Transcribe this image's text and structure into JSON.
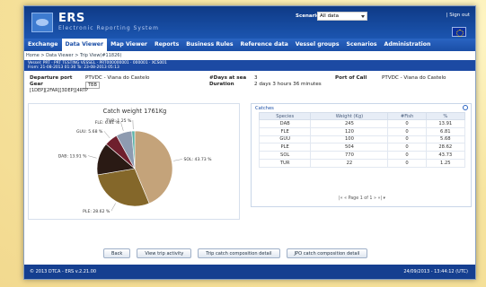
{
  "header": {
    "app_name": "ERS",
    "app_subtitle": "Electronic Reporting System",
    "scenario_label": "Scenario",
    "scenario_value": "All data",
    "sign_out": "| Sign out"
  },
  "nav": [
    "Exchange",
    "Data Viewer",
    "Map Viewer",
    "Reports",
    "Business Rules",
    "Reference data",
    "Vessel groups",
    "Scenarios",
    "Administration"
  ],
  "breadcrumb": "Home > Data Viewer > Trip View(#11826)",
  "vessel_bar": {
    "line1": "Vessel: PRT  ·  PRT TESTING VESSEL  ·  PRT000000001  ·  000001  ·  XCS001",
    "line2": "From: 21-08-2013 01:30 To: 23-08-2013 05:13"
  },
  "trip": {
    "departure_label": "Departure port",
    "departure_value": "PTVDC - Viana do Castelo",
    "gear_label": "Gear",
    "gear_value": "TBB",
    "days_label": "#Days at sea",
    "days_value": "3",
    "duration_label": "Duration",
    "duration_value": "2 days 3 hours 36 minutes",
    "port_label": "Port of Call",
    "port_value": "PTVDC - Viana do Castelo",
    "tags": "[1DEP][2FAR][3DEP][4RTP"
  },
  "chart_data": {
    "type": "pie",
    "title": "Catch weight 1761Kg",
    "series": [
      {
        "name": "SOL",
        "value": 43.73,
        "label": "SOL: 43.73 %",
        "color": "#c4a37a"
      },
      {
        "name": "PLE",
        "value": 28.62,
        "label": "PLE: 28.62 %",
        "color": "#84672a"
      },
      {
        "name": "DAB",
        "value": 13.91,
        "label": "DAB: 13.91 %",
        "color": "#2a1a14"
      },
      {
        "name": "GUU",
        "value": 5.68,
        "label": "GUU: 5.68 %",
        "color": "#6f1f2d"
      },
      {
        "name": "FLE",
        "value": 6.81,
        "label": "FLE: 6.81 %",
        "color": "#8e9bb0"
      },
      {
        "name": "TUR",
        "value": 1.25,
        "label": "TUR: 1.25 %",
        "color": "#5cb3a8"
      }
    ]
  },
  "catches": {
    "title": "Catches",
    "headers": [
      "Species",
      "Weight (Kg)",
      "#Fish",
      "%"
    ],
    "rows": [
      [
        "DAB",
        "245",
        "0",
        "13.91"
      ],
      [
        "FLE",
        "120",
        "0",
        "6.81"
      ],
      [
        "GUU",
        "100",
        "0",
        "5.68"
      ],
      [
        "PLE",
        "504",
        "0",
        "28.62"
      ],
      [
        "SOL",
        "770",
        "0",
        "43.73"
      ],
      [
        "TUR",
        "22",
        "0",
        "1.25"
      ]
    ],
    "pager": "|«  «   Page 1   of 1   »  »|   ▾"
  },
  "buttons": [
    "Back",
    "View trip activity",
    "Trip catch composition detail",
    "JPO catch composition detail"
  ],
  "footer": {
    "left": "© 2013 DTCA - ERS v.2.21.00",
    "right": "24/09/2013 - 13:44:12 (UTC)"
  }
}
